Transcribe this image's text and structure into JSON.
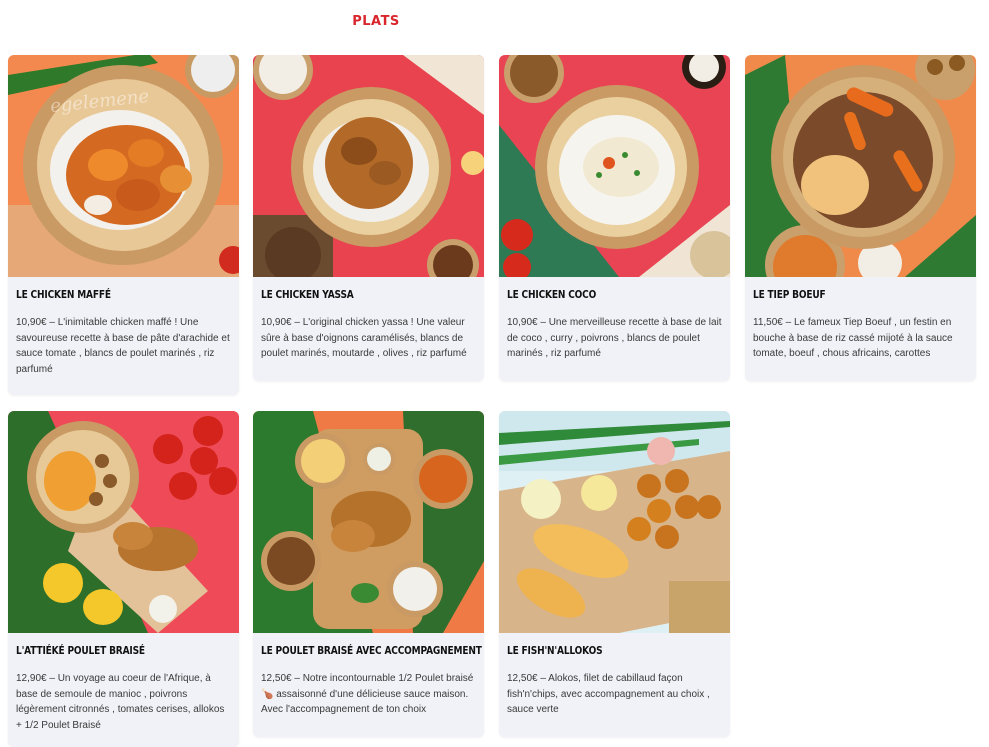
{
  "section": {
    "title": "PLATS"
  },
  "cards": [
    {
      "title": "LE CHICKEN MAFFÉ",
      "desc": "10,90€ – L'inimitable chicken maffé ! Une savoureuse recette à base de pâte d'arachide et sauce tomate , blancs de poulet marinés , riz parfumé"
    },
    {
      "title": "LE CHICKEN YASSA",
      "desc": "10,90€ – L'original chicken yassa ! Une valeur sûre à base d'oignons caramélisés, blancs de poulet marinés, moutarde , olives , riz parfumé"
    },
    {
      "title": "LE CHICKEN COCO",
      "desc": "10,90€ – Une merveilleuse recette à base de lait de coco , curry , poivrons , blancs de poulet marinés , riz parfumé"
    },
    {
      "title": "LE TIEP BOEUF",
      "desc": "11,50€ – Le fameux Tiep Boeuf , un festin en bouche à base de riz cassé mijoté à la sauce tomate, boeuf , chous africains, carottes"
    },
    {
      "title": "L'ATTIÉKÉ POULET BRAISÉ",
      "desc": "12,90€ – Un voyage au coeur de l'Afrique, à base de semoule de manioc , poivrons légèrement citronnés , tomates cerises, allokos + 1/2 Poulet Braisé"
    },
    {
      "title": "LE POULET BRAISÉ AVEC ACCOMPAGNEMENT",
      "desc": "12,50€ – Notre incontournable 1/2 Poulet braisé 🍗 assaisonné d'une délicieuse sauce maison. Avec l'accompagnement de ton choix"
    },
    {
      "title": "LE FISH'N'ALLOKOS",
      "desc": "12,50€ – Alokos, filet de cabillaud façon fish'n'chips, avec accompagnement au choix , sauce verte"
    }
  ],
  "colors": {
    "accent": "#d9262c",
    "card_bg": "#f1f2f7"
  },
  "watermark": "egelemene"
}
